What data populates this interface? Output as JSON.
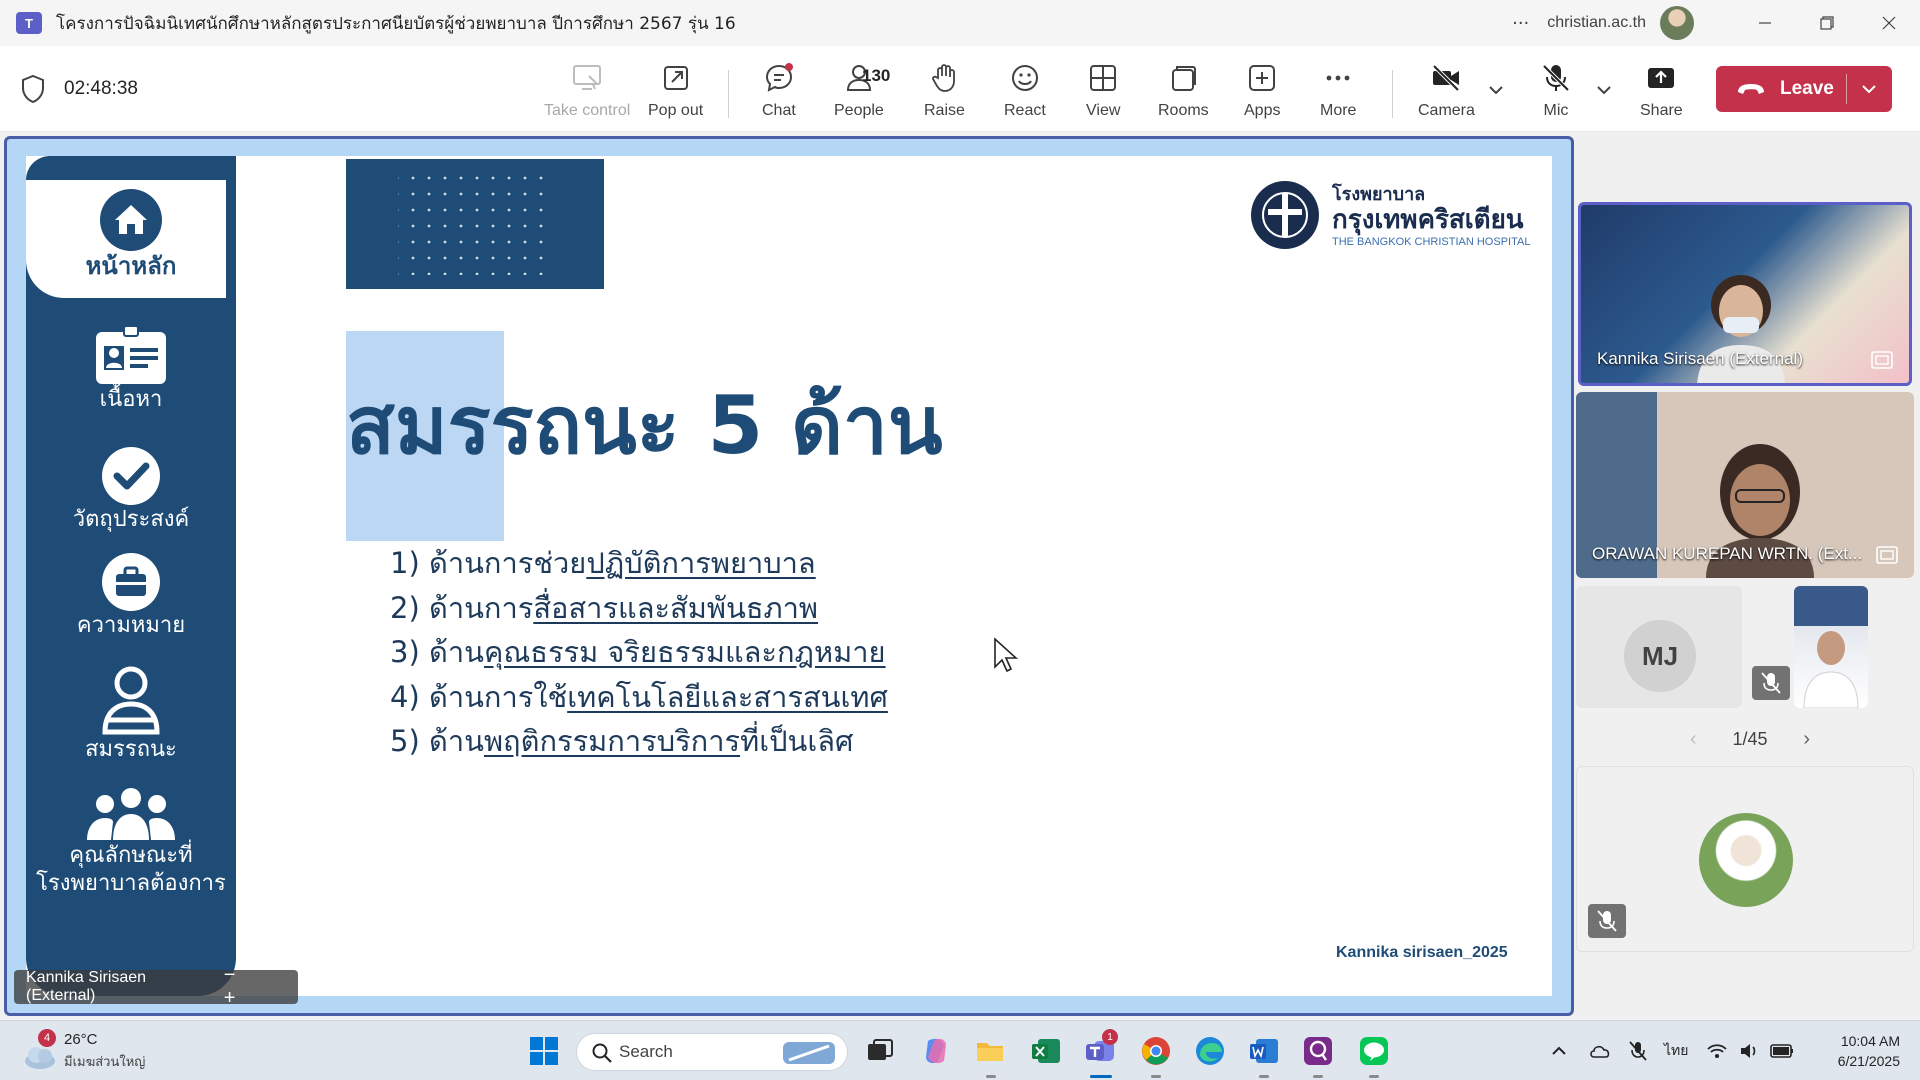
{
  "window": {
    "title": "โครงการปัจฉิมนิเทศนักศึกษาหลักสูตรประกาศนียบัตรผู้ช่วยพยาบาล ปีการศึกษา 2567 รุ่น 16",
    "account": "christian.ac.th",
    "more_glyph": "···"
  },
  "toolbar": {
    "timer": "02:48:38",
    "take_control": "Take control",
    "pop_out": "Pop out",
    "chat": "Chat",
    "people": "People",
    "people_count": "130",
    "raise": "Raise",
    "react": "React",
    "view": "View",
    "rooms": "Rooms",
    "apps": "Apps",
    "more": "More",
    "camera": "Camera",
    "mic": "Mic",
    "share": "Share",
    "leave": "Leave",
    "accent": "#c4314b"
  },
  "slide": {
    "nav": [
      {
        "label": "หน้าหลัก",
        "icon": "home-icon"
      },
      {
        "label": "เนื้อหา",
        "icon": "id-card-icon"
      },
      {
        "label": "วัตถุประสงค์",
        "icon": "checkmark-icon"
      },
      {
        "label": "ความหมาย",
        "icon": "briefcase-icon"
      },
      {
        "label": "สมรรถนะ",
        "icon": "person-icon"
      },
      {
        "label_line1": "คุณลักษณะที่",
        "label_line2": "โรงพยาบาลต้องการ",
        "icon": "group-icon"
      }
    ],
    "logo": {
      "th_line1": "โรงพยาบาล",
      "th_line2": "กรุงเทพคริสเตียน",
      "en": "THE BANGKOK CHRISTIAN HOSPITAL"
    },
    "title": "สมรรถนะ 5 ด้าน",
    "items": [
      {
        "prefix": "1) ด้านการช่วย",
        "underlined": "ปฏิบัติการพยาบาล",
        "suffix": ""
      },
      {
        "prefix": "2) ด้านการ",
        "underlined": "สื่อสารและสัมพันธภาพ",
        "suffix": ""
      },
      {
        "prefix": "3) ด้าน",
        "underlined": "คุณธรรม จริยธรรมและกฎหมาย",
        "suffix": ""
      },
      {
        "prefix": "4) ด้านการใช้",
        "underlined": "เทคโนโลยีและสารสนเทศ",
        "suffix": ""
      },
      {
        "prefix": "5) ด้าน",
        "underlined": "พฤติกรรมการบริการ",
        "suffix": "ที่เป็นเลิศ"
      }
    ],
    "credit": "Kannika sirisaen_2025",
    "brand_color": "#1e4c77"
  },
  "presenter_tag": {
    "name": "Kannika Sirisaen (External)",
    "zoom_out": "−",
    "zoom_in": "+"
  },
  "participants": {
    "tiles": [
      {
        "name": "Kannika Sirisaen (External)"
      },
      {
        "name": "ORAWAN KUREPAN WRTN. (Ext..."
      },
      {
        "initials": "MJ"
      }
    ],
    "pager": "1/45",
    "prev": "‹",
    "next": "›"
  },
  "taskbar": {
    "weather_badge": "4",
    "temperature": "26°C",
    "weather_condition": "มีเมฆส่วนใหญ่",
    "search": "Search",
    "teams_badge": "1",
    "language": "ไทย",
    "time": "10:04 AM",
    "date": "6/21/2025"
  }
}
